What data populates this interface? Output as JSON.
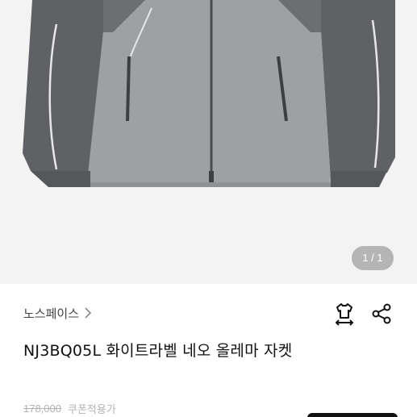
{
  "gallery": {
    "counter": "1 / 1"
  },
  "product": {
    "brand": "노스페이스",
    "name": "NJ3BQ05L 화이트라벨 네오 올레마 자켓",
    "original_price": "178,000",
    "coupon_label": "쿠폰적용가"
  },
  "icons": {
    "brand_chevron": "chevron-right-icon",
    "size_guide": "shirt-size-icon",
    "share": "share-icon"
  },
  "colors": {
    "jacket_body": "#9c9ea2",
    "jacket_sleeves": "#5e6064",
    "piping": "#e6e6e6",
    "background": "#f3f3f3"
  }
}
